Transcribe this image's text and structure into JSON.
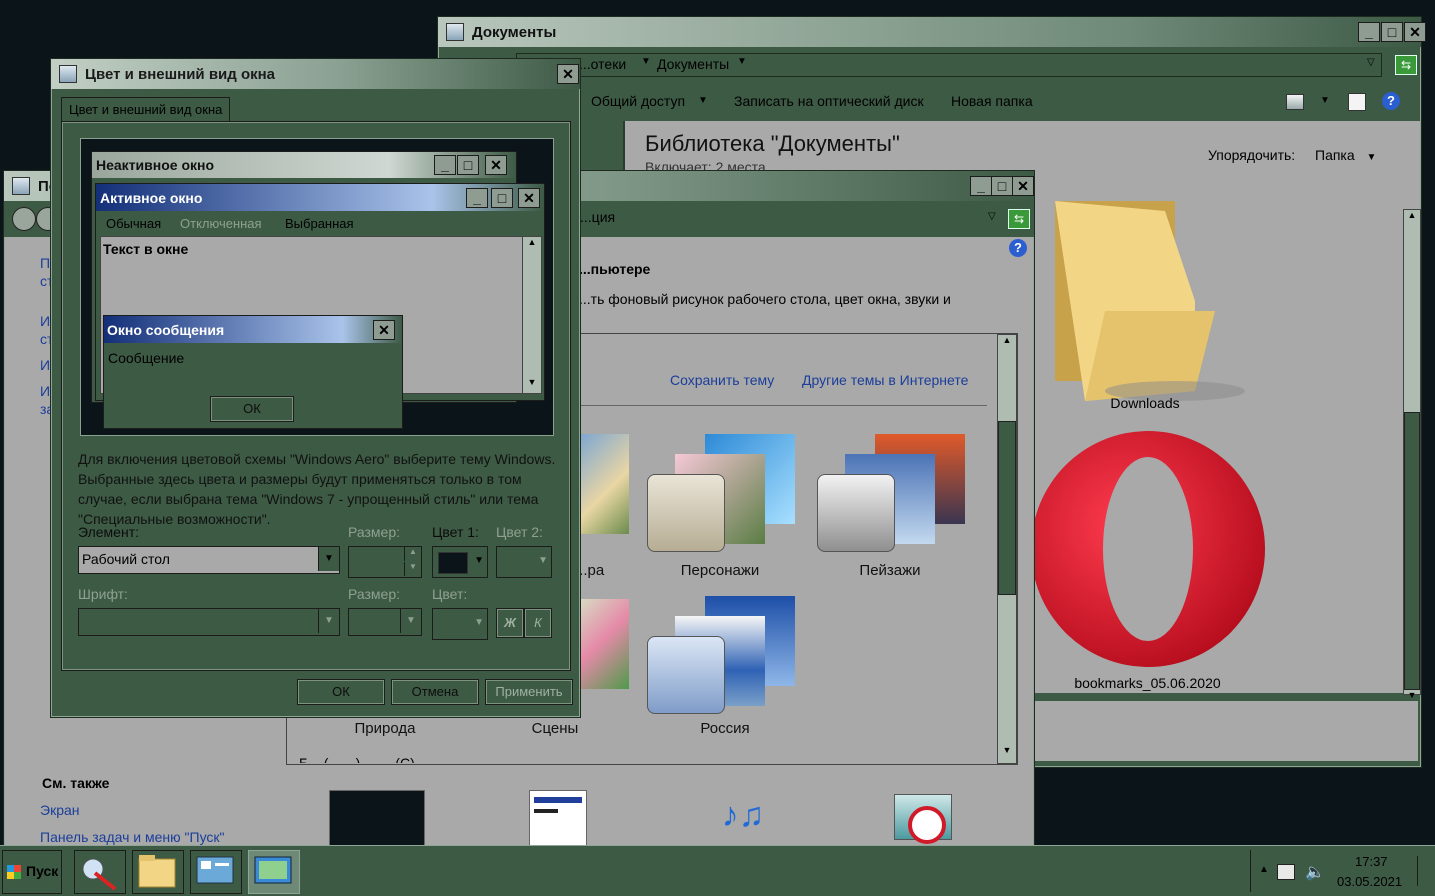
{
  "documents_window": {
    "title": "Документы",
    "address": [
      "...отеки",
      "Документы"
    ],
    "toolbar": {
      "share": "Общий доступ",
      "burn": "Записать на оптический диск",
      "new_folder": "Новая папка"
    },
    "library_title": "Библиотека \"Документы\"",
    "includes": "Включает: 2 места",
    "arrange_label": "Упорядочить:",
    "arrange_value": "Папка",
    "files": [
      {
        "name": "Downloads",
        "icon": "folder-icon"
      },
      {
        "name": "bookmarks_05.06.2020",
        "icon": "opera-icon"
      }
    ]
  },
  "personalization_window": {
    "title": "Пе...",
    "address_tail": "...ция",
    "heading_tail": "...пьютере",
    "desc_tail": "...ть фоновый рисунок рабочего стола, цвет окна, звуки и",
    "save_theme": "Сохранить тему",
    "other_themes": "Другие темы в Интернете",
    "themes_row1": [
      "...ра",
      "Персонажи",
      "Пейзажи"
    ],
    "themes_row2": [
      "Природа",
      "Сцены",
      "Россия"
    ],
    "bottom_hint": "Б... (... ...) ... ... (С)",
    "left_links": [
      "П...",
      "ст...",
      "И...",
      "ст...",
      "И...",
      "И...",
      "за..."
    ],
    "see_also": "См. также",
    "see_also_links": [
      "Экран",
      "Панель задач и меню \"Пуск\""
    ]
  },
  "color_dialog": {
    "title": "Цвет и внешний вид окна",
    "tab": "Цвет и внешний вид окна",
    "preview": {
      "inactive_title": "Неактивное окно",
      "active_title": "Активное окно",
      "menu": [
        "Обычная",
        "Отключенная",
        "Выбранная"
      ],
      "window_text": "Текст в окне",
      "msg_title": "Окно сообщения",
      "msg_text": "Сообщение",
      "msg_ok": "ОК"
    },
    "info": "Для включения цветовой схемы \"Windows Aero\" выберите тему Windows.  Выбранные здесь цвета и размеры будут применяться только в том случае, если выбрана тема \"Windows 7 - упрощенный стиль\" или тема \"Специальные возможности\".",
    "element_label": "Элемент:",
    "element_value": "Рабочий стол",
    "size_label": "Размер:",
    "color1_label": "Цвет 1:",
    "color2_label": "Цвет 2:",
    "font_label": "Шрифт:",
    "font_size_label": "Размер:",
    "font_color_label": "Цвет:",
    "bold_btn": "Ж",
    "italic_btn": "К",
    "ok": "ОК",
    "cancel": "Отмена",
    "apply": "Применить",
    "color1_value": "#0b1418"
  },
  "taskbar": {
    "start": "Пуск",
    "time": "17:37",
    "date": "03.05.2021",
    "apps": [
      "snipping-tool-icon",
      "explorer-icon",
      "control-panel-icon",
      "personalization-icon"
    ]
  }
}
